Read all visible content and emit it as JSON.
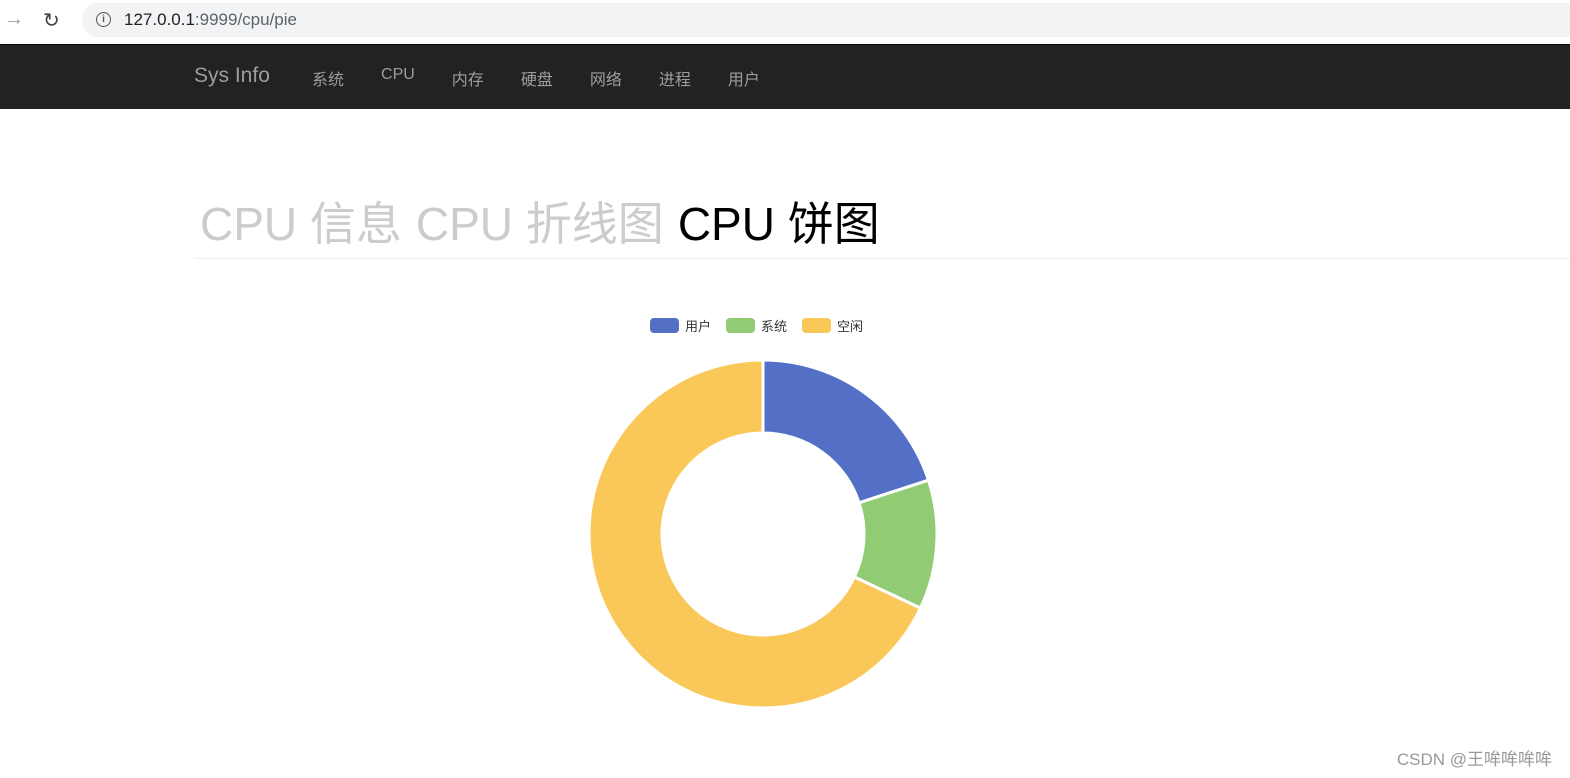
{
  "browser": {
    "url_host": "127.0.0.1",
    "url_rest": ":9999/cpu/pie",
    "back_icon": "arrow-right-icon",
    "reload_icon": "reload-icon",
    "info_icon": "info-icon"
  },
  "navbar": {
    "brand": "Sys Info",
    "items": [
      {
        "label": "系统"
      },
      {
        "label": "CPU"
      },
      {
        "label": "内存"
      },
      {
        "label": "硬盘"
      },
      {
        "label": "网络"
      },
      {
        "label": "进程"
      },
      {
        "label": "用户"
      }
    ]
  },
  "tabs": [
    {
      "label": "CPU 信息",
      "active": false
    },
    {
      "label": "CPU 折线图",
      "active": false
    },
    {
      "label": "CPU 饼图",
      "active": true
    }
  ],
  "chart_data": {
    "type": "pie",
    "variant": "donut",
    "legend_position": "top",
    "categories": [
      "用户",
      "系统",
      "空闲"
    ],
    "values": [
      20,
      12,
      68
    ],
    "colors": [
      "#5470c6",
      "#91cc75",
      "#fac858"
    ]
  },
  "watermark": "CSDN @王哞哞哞哞"
}
